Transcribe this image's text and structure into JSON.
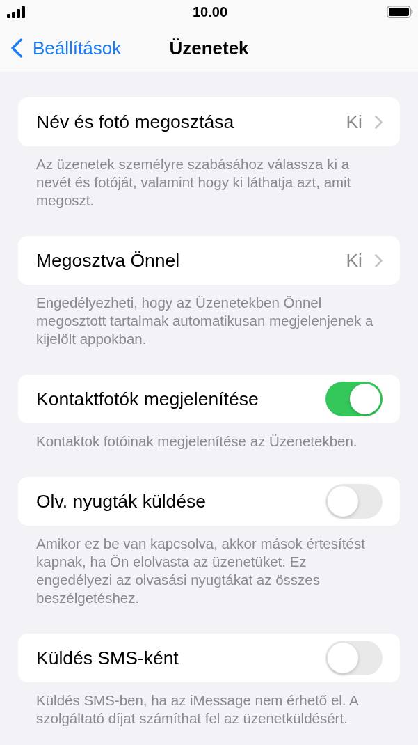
{
  "status_bar": {
    "time": "10.00"
  },
  "nav": {
    "back_label": "Beállítások",
    "title": "Üzenetek"
  },
  "sections": [
    {
      "kind": "link",
      "label": "Név és fotó megosztása",
      "value": "Ki",
      "footer": "Az üzenetek személyre szabásához válassza ki a nevét és fotóját, valamint hogy ki láthatja azt, amit megoszt."
    },
    {
      "kind": "link",
      "label": "Megosztva Önnel",
      "value": "Ki",
      "footer": "Engedélyezheti, hogy az Üzenetekben Önnel megosztott tartalmak automatikusan megjelenjenek a kijelölt appokban."
    },
    {
      "kind": "toggle",
      "label": "Kontaktfotók megjelenítése",
      "on": true,
      "footer": "Kontaktok fotóinak megjelenítése az Üzenetekben."
    },
    {
      "kind": "toggle",
      "label": "Olv. nyugták küldése",
      "on": false,
      "footer": "Amikor ez be van kapcsolva, akkor mások értesítést kapnak, ha Ön elolvasta az üzenetüket. Ez engedélyezi az olvasási nyugtákat az összes beszélgetéshez."
    },
    {
      "kind": "toggle",
      "label": "Küldés SMS-ként",
      "on": false,
      "footer": "Küldés SMS-ben, ha az iMessage nem érhető el. A szolgáltató díjat számíthat fel az üzenetküldésért."
    }
  ]
}
